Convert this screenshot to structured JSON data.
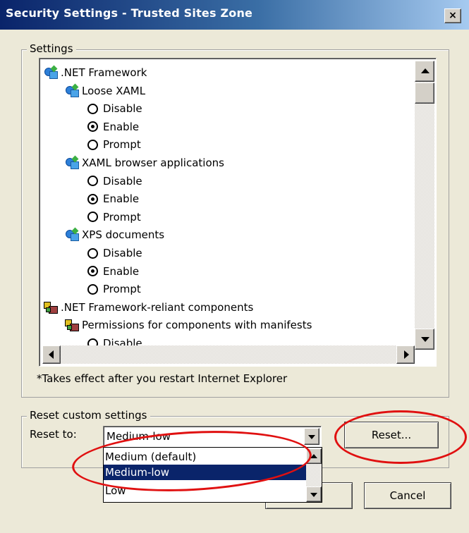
{
  "window": {
    "title": "Security Settings - Trusted Sites Zone",
    "close_label": "×"
  },
  "settings": {
    "group_label": "Settings",
    "tree": [
      {
        "kind": "category",
        "icon": "net-framework-icon",
        "label": ".NET Framework"
      },
      {
        "kind": "setting",
        "icon": "net-framework-icon",
        "label": "Loose XAML"
      },
      {
        "kind": "option",
        "label": "Disable",
        "selected": false
      },
      {
        "kind": "option",
        "label": "Enable",
        "selected": true
      },
      {
        "kind": "option",
        "label": "Prompt",
        "selected": false
      },
      {
        "kind": "setting",
        "icon": "net-framework-icon",
        "label": "XAML browser applications"
      },
      {
        "kind": "option",
        "label": "Disable",
        "selected": false
      },
      {
        "kind": "option",
        "label": "Enable",
        "selected": true
      },
      {
        "kind": "option",
        "label": "Prompt",
        "selected": false
      },
      {
        "kind": "setting",
        "icon": "net-framework-icon",
        "label": "XPS documents"
      },
      {
        "kind": "option",
        "label": "Disable",
        "selected": false
      },
      {
        "kind": "option",
        "label": "Enable",
        "selected": true
      },
      {
        "kind": "option",
        "label": "Prompt",
        "selected": false
      },
      {
        "kind": "category",
        "icon": "components-icon",
        "label": ".NET Framework-reliant components"
      },
      {
        "kind": "setting",
        "icon": "components-icon",
        "label": "Permissions for components with manifests"
      },
      {
        "kind": "option",
        "label": "Disable",
        "selected": false
      }
    ],
    "note": "*Takes effect after you restart Internet Explorer"
  },
  "reset": {
    "group_label": "Reset custom settings",
    "reset_to_label": "Reset to:",
    "combo_value": "Medium-low",
    "options": [
      {
        "label": "Medium (default)",
        "selected": false
      },
      {
        "label": "Medium-low",
        "selected": true
      },
      {
        "label": "Low",
        "selected": false
      }
    ],
    "reset_button": "Reset..."
  },
  "footer": {
    "ok_button": "",
    "cancel_button": "Cancel"
  },
  "colors": {
    "selection": "#0a246a",
    "annotation": "#e01010",
    "dialog_bg": "#ece9d8"
  }
}
